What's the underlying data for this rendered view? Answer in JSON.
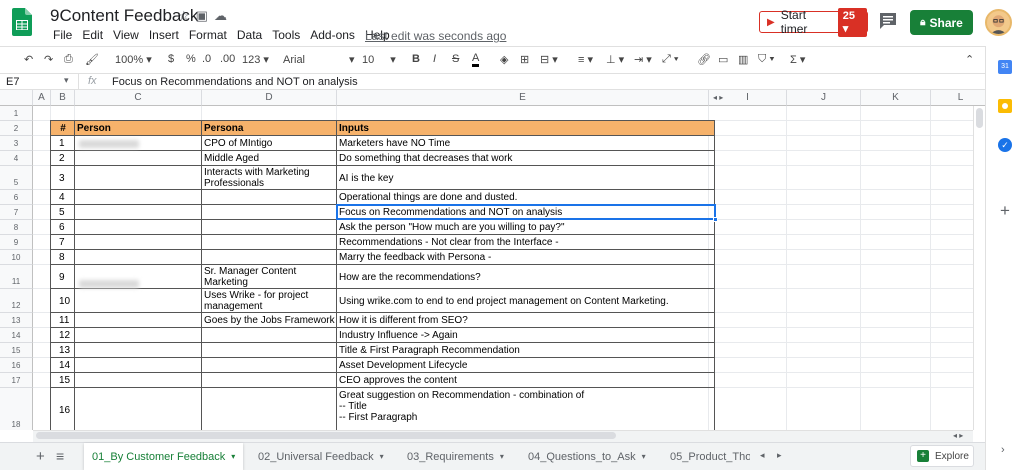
{
  "app": {
    "doc_title": "9Content Feedback",
    "menu": [
      "File",
      "Edit",
      "View",
      "Insert",
      "Format",
      "Data",
      "Tools",
      "Add-ons",
      "Help"
    ],
    "last_edit": "Last edit was seconds ago",
    "timer_label": "Start timer",
    "timer_count": "25",
    "share_label": "Share"
  },
  "toolbar": {
    "zoom": "100%",
    "currency": "$",
    "percent": "%",
    "dec_less": ".0",
    "dec_more": ".00",
    "more_formats": "123",
    "font": "Arial",
    "font_size": "10"
  },
  "formula_bar": {
    "cell_ref": "E7",
    "fx": "fx",
    "value": "Focus on Recommendations and NOT on analysis"
  },
  "columns": [
    "A",
    "B",
    "C",
    "D",
    "E",
    "I",
    "J",
    "K",
    "L"
  ],
  "row_numbers": [
    "1",
    "2",
    "3",
    "4",
    "5",
    "6",
    "7",
    "8",
    "9",
    "10",
    "11",
    "12",
    "13",
    "14",
    "15",
    "16",
    "17",
    "18"
  ],
  "table": {
    "headers": [
      "#",
      "Person",
      "Persona",
      "Inputs"
    ],
    "rows": [
      {
        "num": "1",
        "persona": "CPO of MIntigo",
        "input": "Marketers have NO Time"
      },
      {
        "num": "2",
        "persona": "Middle Aged",
        "input": "Do something that decreases that work"
      },
      {
        "num": "3",
        "persona": "Interacts with Marketing Professionals",
        "input": "AI is the key"
      },
      {
        "num": "4",
        "persona": "",
        "input": "Operational things are done and dusted."
      },
      {
        "num": "5",
        "persona": "",
        "input": "Focus on Recommendations and NOT on analysis"
      },
      {
        "num": "6",
        "persona": "",
        "input": "Ask the person \"How much are you willing to pay?\""
      },
      {
        "num": "7",
        "persona": "",
        "input": "Recommendations - Not clear from the Interface -"
      },
      {
        "num": "8",
        "persona": "",
        "input": "Marry the feedback with Persona -"
      },
      {
        "num": "9",
        "persona": "Sr. Manager Content Marketing",
        "input": "How are the recommendations?"
      },
      {
        "num": "10",
        "persona": "Uses Wrike - for project management",
        "input": "Using wrike.com to end to end project management on Content Marketing."
      },
      {
        "num": "11",
        "persona": "Goes by the Jobs Framework",
        "input": "How it is different from SEO?"
      },
      {
        "num": "12",
        "persona": "",
        "input": "Industry Influence -> Again"
      },
      {
        "num": "13",
        "persona": "",
        "input": "Title & First Paragraph Recommendation"
      },
      {
        "num": "14",
        "persona": "",
        "input": "Asset Development Lifecycle"
      },
      {
        "num": "15",
        "persona": "",
        "input": "CEO approves the content"
      },
      {
        "num": "16",
        "persona": "",
        "input": "Great suggestion on Recommendation - combination of\n-- Title\n-- First Paragraph"
      }
    ]
  },
  "sheet_tabs": [
    "01_By Customer Feedback",
    "02_Universal Feedback",
    "03_Requirements",
    "04_Questions_to_Ask",
    "05_Product_Tho"
  ],
  "explore_label": "Explore",
  "colors": {
    "header_fill": "#f6b26b",
    "accent_green": "#188038",
    "selection": "#1a73e8",
    "timer_red": "#d93025"
  }
}
